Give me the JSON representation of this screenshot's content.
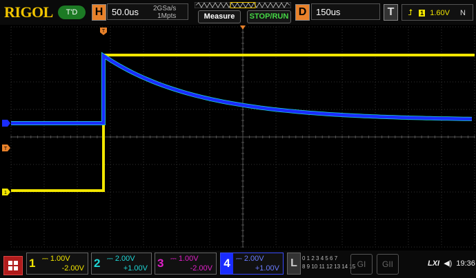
{
  "brand": "RIGOL",
  "run_state": "T'D",
  "horizontal": {
    "key": "H",
    "timebase": "50.0us",
    "sample_rate": "2GSa/s",
    "memory_depth": "1Mpts"
  },
  "buttons": {
    "measure": "Measure",
    "stop_run": "STOP/RUN"
  },
  "delay": {
    "key": "D",
    "value": "150us"
  },
  "trigger": {
    "key": "T",
    "channel": "1",
    "level": "1.60V",
    "mode": "N"
  },
  "markers": {
    "trigger_position": "T",
    "ch1_ground": "1"
  },
  "channels": [
    {
      "num": "1",
      "scale": "1.00V",
      "offset": "-2.00V",
      "color": "#f2e600"
    },
    {
      "num": "2",
      "scale": "2.00V",
      "offset": "+1.00V",
      "color": "#1fd6d6"
    },
    {
      "num": "3",
      "scale": "1.00V",
      "offset": "-2.00V",
      "color": "#e020c8"
    },
    {
      "num": "4",
      "scale": "2.00V",
      "offset": "+1.00V",
      "color": "#2a3cff"
    }
  ],
  "logic": {
    "key": "L",
    "row1": "0 1 2 3 4 5 6 7",
    "row2": "8 9 10 11 12 13 14 15"
  },
  "generators": [
    "GI",
    "GII"
  ],
  "status": {
    "lxi": "LXI",
    "speaker": "◀)",
    "time": "19:36"
  },
  "colors": {
    "ch1": "#f2e600",
    "ch2": "#1fd6d6",
    "ch4": "#1a2cff",
    "trigger_marker": "#e8812a"
  }
}
